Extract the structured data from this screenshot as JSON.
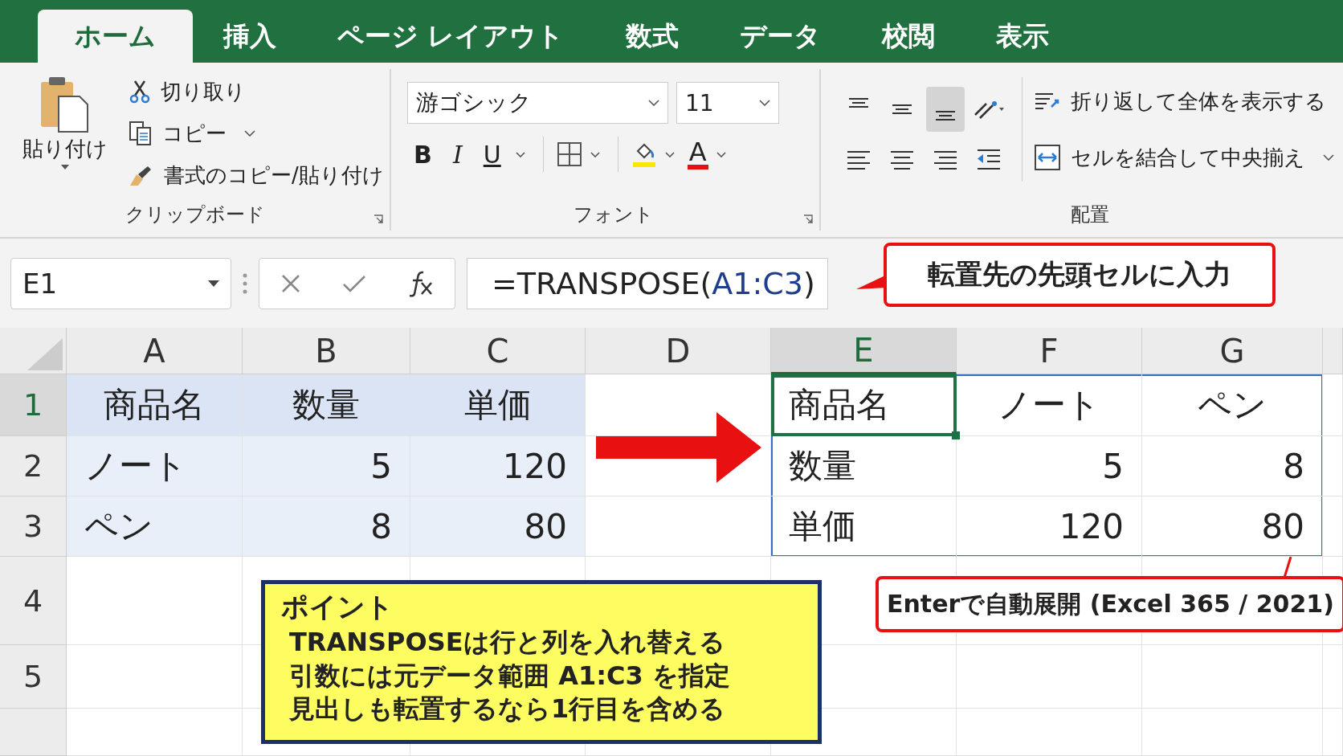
{
  "tabs": [
    {
      "label": "ホーム",
      "selected": true
    },
    {
      "label": "挿入",
      "selected": false
    },
    {
      "label": "ページ レイアウト",
      "selected": false
    },
    {
      "label": "数式",
      "selected": false
    },
    {
      "label": "データ",
      "selected": false
    },
    {
      "label": "校閲",
      "selected": false
    },
    {
      "label": "表示",
      "selected": false
    }
  ],
  "clipboard": {
    "paste": "貼り付け",
    "cut": "切り取り",
    "copy": "コピー",
    "format_painter": "書式のコピー/貼り付け",
    "group_label": "クリップボード"
  },
  "font": {
    "name": "游ゴシック",
    "size": "11",
    "bold": "B",
    "italic": "I",
    "underline": "U",
    "fill_letter": "A",
    "group_label": "フォント"
  },
  "alignment": {
    "vertical_buttons": [
      {
        "selected": false
      },
      {
        "selected": false
      },
      {
        "selected": true
      }
    ],
    "wrap_text": "折り返して全体を表示する",
    "merge_center": "セルを結合して中央揃え",
    "group_label": "配置"
  },
  "name_box": "E1",
  "formula": {
    "prefix": "=TRANSPOSE(",
    "reference": "A1:C3",
    "suffix": ")"
  },
  "formula_callout": "転置先の先頭セルに入力",
  "sheet": {
    "columns": [
      {
        "label": "A",
        "selected": false
      },
      {
        "label": "B",
        "selected": false
      },
      {
        "label": "C",
        "selected": false
      },
      {
        "label": "D",
        "selected": false
      },
      {
        "label": "E",
        "selected": true
      },
      {
        "label": "F",
        "selected": false
      },
      {
        "label": "G",
        "selected": false
      }
    ],
    "rows": [
      {
        "number": "1",
        "selected": true,
        "source": [
          {
            "text": "商品名",
            "kind": "heading"
          },
          {
            "text": "数量",
            "kind": "heading"
          },
          {
            "text": "単価",
            "kind": "heading"
          }
        ],
        "result": [
          {
            "text": "商品名",
            "kind": "text",
            "active": true
          },
          {
            "text": "ノート",
            "kind": "heading",
            "active": false
          },
          {
            "text": "ペン",
            "kind": "heading",
            "active": false
          }
        ]
      },
      {
        "number": "2",
        "selected": false,
        "source": [
          {
            "text": "ノート",
            "kind": "text"
          },
          {
            "text": "5",
            "kind": "number"
          },
          {
            "text": "120",
            "kind": "number"
          }
        ],
        "result": [
          {
            "text": "数量",
            "kind": "text",
            "active": false
          },
          {
            "text": "5",
            "kind": "number",
            "active": false
          },
          {
            "text": "8",
            "kind": "number",
            "active": false
          }
        ]
      },
      {
        "number": "3",
        "selected": false,
        "source": [
          {
            "text": "ペン",
            "kind": "text"
          },
          {
            "text": "8",
            "kind": "number"
          },
          {
            "text": "80",
            "kind": "number"
          }
        ],
        "result": [
          {
            "text": "単価",
            "kind": "text",
            "active": false
          },
          {
            "text": "120",
            "kind": "number",
            "active": false
          },
          {
            "text": "80",
            "kind": "number",
            "active": false
          }
        ]
      },
      {
        "number": "4",
        "selected": false
      },
      {
        "number": "5",
        "selected": false
      }
    ]
  },
  "point": {
    "title": "ポイント",
    "lines": [
      "TRANSPOSEは行と列を入れ替える",
      "引数には元データ範囲 A1:C3 を指定",
      "見出しも転置するなら1行目を含める"
    ]
  },
  "spill_callout": "Enterで自動展開 (Excel 365 / 2021)"
}
